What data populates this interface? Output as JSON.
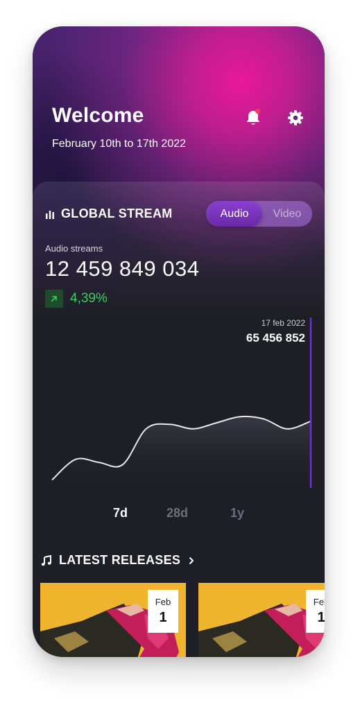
{
  "header": {
    "title": "Welcome",
    "date_range": "February 10th to 17th 2022",
    "notification_badge_color": "#ff3b5c"
  },
  "global_stream": {
    "title": "GLOBAL STREAM",
    "toggle": {
      "options": [
        "Audio",
        "Video"
      ],
      "selected": "Audio"
    },
    "streams_label": "Audio streams",
    "streams_value": "12 459 849 034",
    "change_pct": "4,39%",
    "tooltip": {
      "date": "17 feb 2022",
      "value": "65 456 852"
    },
    "range_tabs": [
      {
        "label": "7d",
        "active": true
      },
      {
        "label": "28d",
        "active": false
      },
      {
        "label": "1y",
        "active": false
      }
    ]
  },
  "chart_data": {
    "type": "line",
    "series": [
      {
        "values": [
          0.05,
          0.32,
          0.28,
          0.25,
          0.72,
          0.78,
          0.72,
          0.8,
          0.88,
          0.85,
          0.72,
          0.82
        ]
      }
    ],
    "highlight_index": 11,
    "accent_color": "#6a2bd8"
  },
  "latest_releases": {
    "title": "LATEST RELEASES",
    "items": [
      {
        "month": "Feb",
        "day": "1"
      },
      {
        "month": "Feb",
        "day": "1"
      }
    ]
  },
  "colors": {
    "background": "#1e1f26",
    "accent_pink": "#e8189a",
    "positive_green": "#35d35d",
    "release_bg": "#f0b52e"
  }
}
